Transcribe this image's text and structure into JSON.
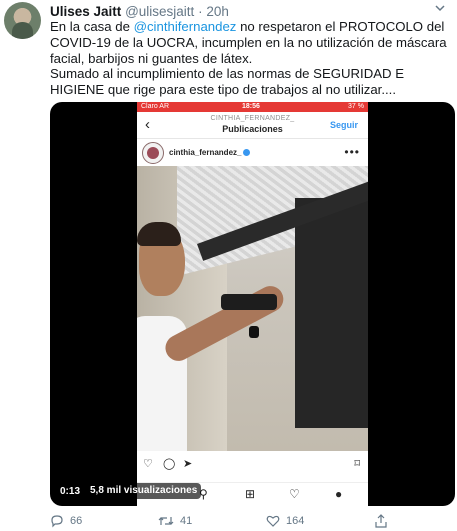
{
  "tweet": {
    "name": "Ulises Jaitt",
    "handle": "@ulisesjaitt",
    "separator": "·",
    "time": "20h",
    "text_part1": "En la casa de ",
    "mention": "@cinthifernandez",
    "text_part2": " no respetaron el PROTOCOLO del COVID-19 de la UOCRA, incumplen en la no utilización de máscara facial, barbijos ni guantes de látex.",
    "text_para2": "Sumado al incumplimiento de las normas de SEGURIDAD E HIGIENE que rige para este tipo de trabajos al no utilizar....",
    "counts": {
      "replies": "66",
      "retweets": "41",
      "likes": "164"
    }
  },
  "video": {
    "elapsed": "0:13",
    "views": "5,8 mil visualizaciones",
    "instagram": {
      "status_left": "Claro AR",
      "status_time": "18:56",
      "status_battery": "37 %",
      "username_caption": "CINTHIA_FERNANDEZ_",
      "title": "Publicaciones",
      "follow": "Seguir",
      "post_user": "cinthia_fernandez_",
      "more": "•••"
    }
  },
  "colors": {
    "accent": "#1b95e0",
    "muted": "#657786",
    "ig_blue": "#3897f0",
    "status_red": "#e53935"
  },
  "icons": [
    "chevron-down-icon",
    "reply-icon",
    "retweet-icon",
    "like-icon",
    "share-icon"
  ]
}
